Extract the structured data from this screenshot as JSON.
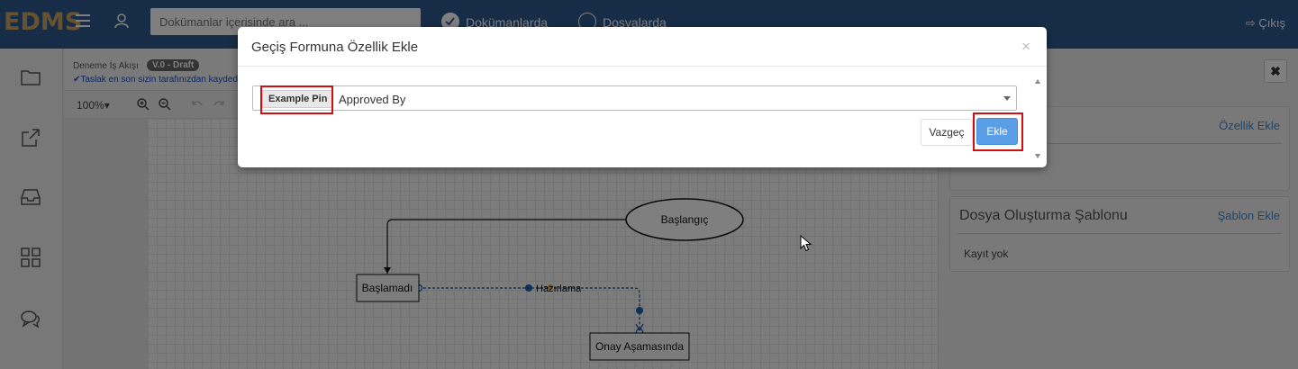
{
  "topbar": {
    "logo": "EDMS",
    "search_placeholder": "Dokümanlar içerisinde ara ...",
    "radio_documents": "Dokümanlarda",
    "radio_folders": "Dosyalarda",
    "logout": "Çıkış"
  },
  "editor": {
    "title": "Deneme İş Akışı",
    "version_badge": "V.0 - Draft",
    "saved_note": "✔Taslak en son sizin tarafınızdan kaydedildi",
    "zoom": "100%▾"
  },
  "diagram": {
    "start_node": "Başlangıç",
    "not_started_node": "Başlamadı",
    "approval_node": "Onay Aşamasında",
    "edge_label": "Hazırlama"
  },
  "rightpanel": {
    "close": "✖",
    "card1_link": "Özellik Ekle",
    "card2_title": "Dosya Oluşturma Şablonu",
    "card2_link": "Şablon Ekle",
    "card2_body": "Kayıt yok"
  },
  "modal": {
    "title": "Geçiş Formuna Özellik Ekle",
    "close": "×",
    "pin_tag": "Example Pin",
    "select_value": "Approved By",
    "cancel_label": "Vazgeç",
    "add_label": "Ekle"
  },
  "colors": {
    "topbar": "#2e5a8f",
    "logo": "#c8a560",
    "primary_button": "#5b9ee8",
    "highlight": "#d01010",
    "link": "#3d8bd9"
  }
}
